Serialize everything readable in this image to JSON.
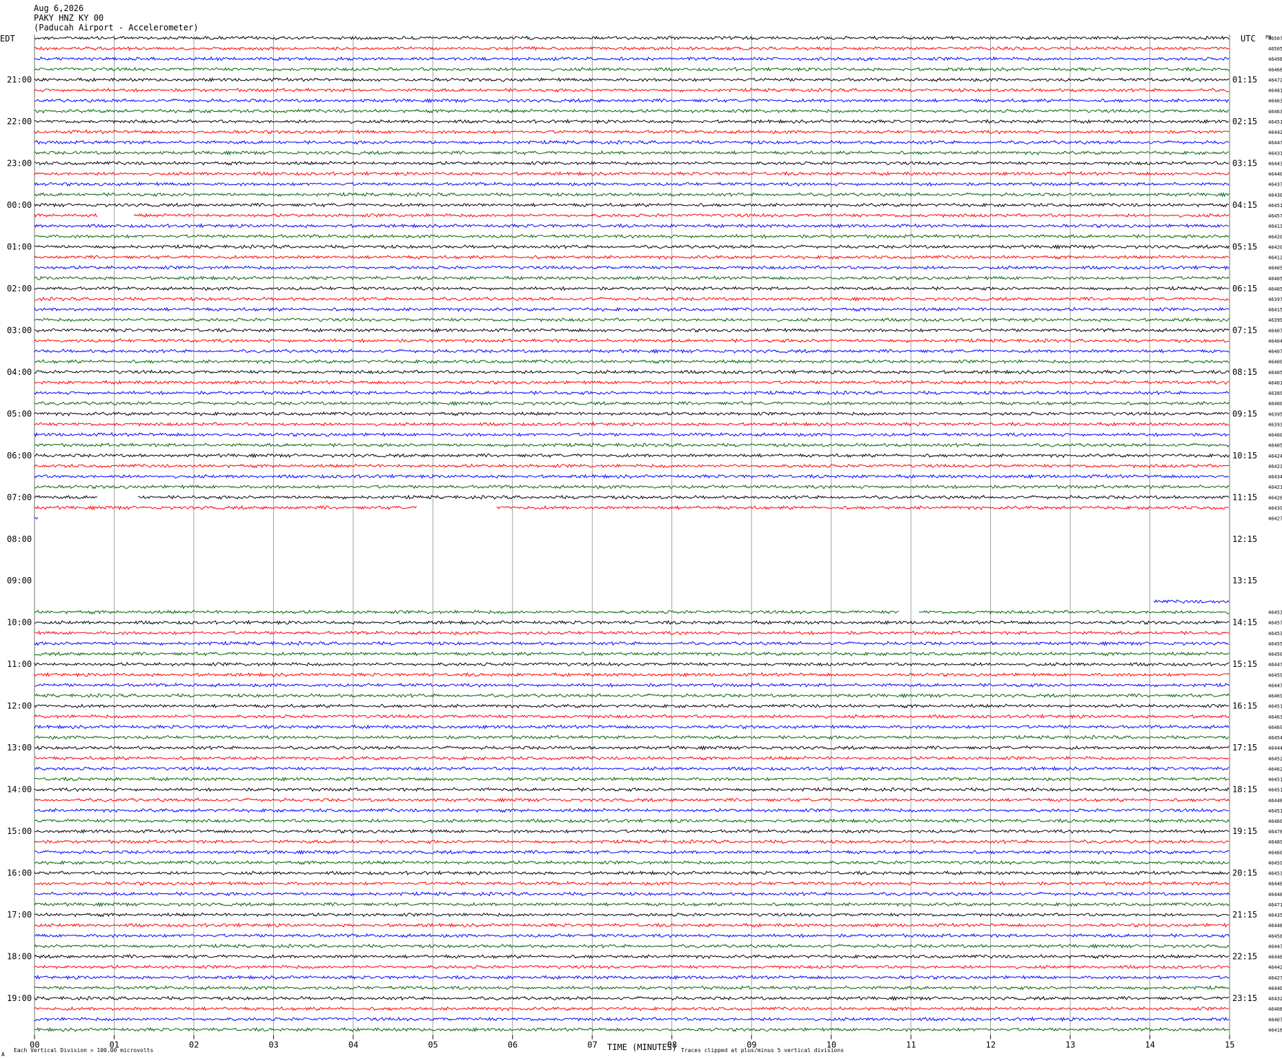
{
  "header": {
    "date": "Aug 6,2026",
    "station": "PAKY HNZ KY 00",
    "site": "(Paducah Airport - Accelerometer)"
  },
  "left_tz": "EDT",
  "right_tz": "UTC",
  "corner_label": "PN",
  "footer": {
    "x_title": "TIME (MINUTES)",
    "scale_note": "Each Vertical Division =  100.00 microvolts",
    "clip_note": "Traces clipped at plus/minus 5 vertical divisions",
    "mark": "A"
  },
  "colors": [
    "#000000",
    "#ff0000",
    "#0000ff",
    "#006400"
  ],
  "chart_data": {
    "type": "line",
    "x_ticks": [
      "00",
      "01",
      "02",
      "03",
      "04",
      "05",
      "06",
      "07",
      "08",
      "09",
      "10",
      "11",
      "12",
      "13",
      "14",
      "15"
    ],
    "xlim": [
      0,
      15
    ],
    "left_hour_labels": [
      "21:00",
      "22:00",
      "23:00",
      "00:00",
      "01:00",
      "02:00",
      "03:00",
      "04:00",
      "05:00",
      "06:00",
      "07:00",
      "08:00",
      "09:00",
      "10:00",
      "11:00",
      "12:00",
      "13:00",
      "14:00",
      "15:00",
      "16:00",
      "17:00",
      "18:00",
      "19:00"
    ],
    "right_hour_labels": [
      "01:15",
      "02:15",
      "03:15",
      "04:15",
      "05:15",
      "06:15",
      "07:15",
      "08:15",
      "09:15",
      "10:15",
      "11:15",
      "12:15",
      "13:15",
      "14:15",
      "15:15",
      "16:15",
      "17:15",
      "18:15",
      "19:15",
      "20:15",
      "21:15",
      "22:15",
      "23:15"
    ],
    "rows": [
      {
        "label": "46507"
      },
      {
        "label": "46505"
      },
      {
        "label": "46498"
      },
      {
        "label": "46466"
      },
      {
        "label": "46472"
      },
      {
        "label": "46481"
      },
      {
        "label": "46463"
      },
      {
        "label": "46463"
      },
      {
        "label": "46451"
      },
      {
        "label": "46442"
      },
      {
        "label": "46447"
      },
      {
        "label": "46431"
      },
      {
        "label": "46443"
      },
      {
        "label": "46440"
      },
      {
        "label": "46437"
      },
      {
        "label": "46430"
      },
      {
        "label": "46451"
      },
      {
        "label": "46457",
        "gaps": [
          [
            0.8,
            1.25
          ]
        ]
      },
      {
        "label": "46413"
      },
      {
        "label": "46420"
      },
      {
        "label": "46420"
      },
      {
        "label": "46412"
      },
      {
        "label": "46405"
      },
      {
        "label": "46405"
      },
      {
        "label": "46405"
      },
      {
        "label": "46397"
      },
      {
        "label": "46415"
      },
      {
        "label": "46399"
      },
      {
        "label": "46407"
      },
      {
        "label": "46404"
      },
      {
        "label": "46407"
      },
      {
        "label": "46400"
      },
      {
        "label": "46405"
      },
      {
        "label": "46401"
      },
      {
        "label": "46389"
      },
      {
        "label": "46400"
      },
      {
        "label": "46395"
      },
      {
        "label": "46393"
      },
      {
        "label": "46400"
      },
      {
        "label": "46405"
      },
      {
        "label": "46424"
      },
      {
        "label": "46423"
      },
      {
        "label": "46434"
      },
      {
        "label": "46421"
      },
      {
        "label": "46428",
        "gaps": [
          [
            0.8,
            1.3
          ]
        ]
      },
      {
        "label": "46439",
        "gaps": [
          [
            4.8,
            5.8
          ]
        ]
      },
      {
        "label": "46427",
        "segs": [
          [
            0,
            0.05
          ]
        ]
      },
      {
        "label": "",
        "segs": []
      },
      {
        "label": "",
        "segs": []
      },
      {
        "label": "",
        "segs": []
      },
      {
        "label": "",
        "segs": []
      },
      {
        "label": "",
        "segs": []
      },
      {
        "label": "",
        "segs": []
      },
      {
        "label": "",
        "segs": []
      },
      {
        "label": "",
        "segs": [
          [
            14.05,
            15
          ]
        ]
      },
      {
        "label": "46453",
        "gaps": [
          [
            10.85,
            11.1
          ]
        ]
      },
      {
        "label": "46457"
      },
      {
        "label": "46453"
      },
      {
        "label": "46455"
      },
      {
        "label": "46450"
      },
      {
        "label": "46447"
      },
      {
        "label": "46459"
      },
      {
        "label": "46447"
      },
      {
        "label": "46469"
      },
      {
        "label": "46451"
      },
      {
        "label": "46463"
      },
      {
        "label": "46469"
      },
      {
        "label": "46454"
      },
      {
        "label": "46444"
      },
      {
        "label": "46452"
      },
      {
        "label": "46462"
      },
      {
        "label": "46451"
      },
      {
        "label": "46451"
      },
      {
        "label": "46448"
      },
      {
        "label": "46451"
      },
      {
        "label": "46460"
      },
      {
        "label": "46478"
      },
      {
        "label": "46489"
      },
      {
        "label": "46460"
      },
      {
        "label": "46459"
      },
      {
        "label": "46453"
      },
      {
        "label": "46446"
      },
      {
        "label": "46448"
      },
      {
        "label": "46471"
      },
      {
        "label": "46435"
      },
      {
        "label": "46448"
      },
      {
        "label": "46458"
      },
      {
        "label": "46447"
      },
      {
        "label": "46448"
      },
      {
        "label": "46442"
      },
      {
        "label": "46427"
      },
      {
        "label": "46440"
      },
      {
        "label": "46432"
      },
      {
        "label": "46408"
      },
      {
        "label": "46407"
      },
      {
        "label": "46416"
      }
    ]
  }
}
